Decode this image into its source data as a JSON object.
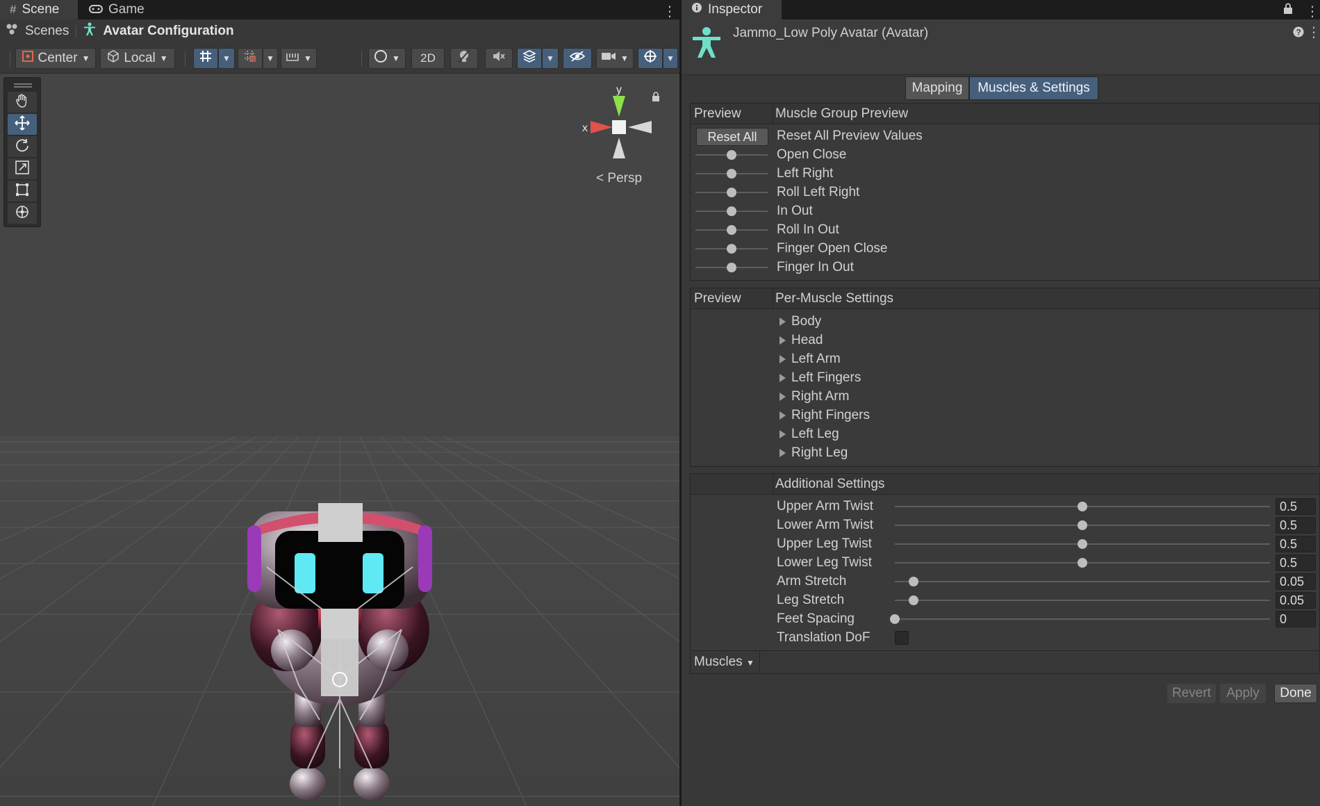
{
  "scene_panel": {
    "tabs": {
      "scene": "Scene",
      "game": "Game"
    },
    "breadcrumb": {
      "root": "Scenes",
      "current": "Avatar Configuration"
    },
    "toolbar": {
      "pivot": "Center",
      "space": "Local",
      "mode_2d": "2D"
    },
    "gizmo": {
      "x": "x",
      "y": "y",
      "projection": "Persp"
    }
  },
  "inspector": {
    "tab": "Inspector",
    "title": "Jammo_Low Poly Avatar (Avatar)",
    "tabs": {
      "mapping": "Mapping",
      "muscles": "Muscles & Settings"
    },
    "muscle_group": {
      "col1": "Preview",
      "col2": "Muscle Group Preview",
      "reset_button": "Reset All",
      "reset_label": "Reset All Preview Values",
      "sliders": [
        "Open Close",
        "Left Right",
        "Roll Left Right",
        "In Out",
        "Roll In Out",
        "Finger Open Close",
        "Finger In Out"
      ]
    },
    "per_muscle": {
      "col1": "Preview",
      "col2": "Per-Muscle Settings",
      "groups": [
        "Body",
        "Head",
        "Left Arm",
        "Left Fingers",
        "Right Arm",
        "Right Fingers",
        "Left Leg",
        "Right Leg"
      ]
    },
    "additional": {
      "title": "Additional Settings",
      "settings": [
        {
          "label": "Upper Arm Twist",
          "value": "0.5",
          "fraction": 0.5
        },
        {
          "label": "Lower Arm Twist",
          "value": "0.5",
          "fraction": 0.5
        },
        {
          "label": "Upper Leg Twist",
          "value": "0.5",
          "fraction": 0.5
        },
        {
          "label": "Lower Leg Twist",
          "value": "0.5",
          "fraction": 0.5
        },
        {
          "label": "Arm Stretch",
          "value": "0.05",
          "fraction": 0.05
        },
        {
          "label": "Leg Stretch",
          "value": "0.05",
          "fraction": 0.05
        },
        {
          "label": "Feet Spacing",
          "value": "0",
          "fraction": 0.0
        }
      ],
      "translation_dof": "Translation DoF",
      "translation_dof_checked": false
    },
    "muscles_dropdown": "Muscles",
    "buttons": {
      "revert": "Revert",
      "apply": "Apply",
      "done": "Done"
    }
  },
  "colors": {
    "accent": "#46607c",
    "avatar_icon": "#6fe0c8",
    "robot_pink": "#c0405a"
  }
}
